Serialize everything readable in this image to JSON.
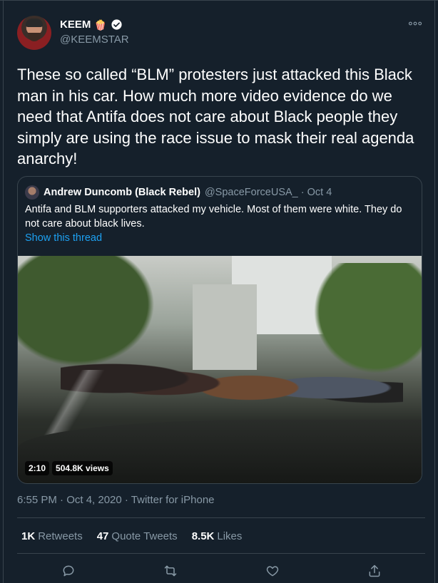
{
  "author": {
    "display_name": "KEEM",
    "handle": "@KEEMSTAR",
    "emoji": "🍿"
  },
  "tweet": {
    "text": "These so called “BLM” protesters just attacked this Black man in his car. How much more video evidence do we need that Antifa does not care about Black people they simply are using the race issue to mask their real agenda anarchy!"
  },
  "quoted": {
    "display_name": "Andrew Duncomb (Black Rebel)",
    "handle_date": "@SpaceForceUSA_ · Oct 4",
    "text": "Antifa and BLM supporters attacked my vehicle. Most of them were white. They do not care about black lives.",
    "show_thread": "Show this thread",
    "video": {
      "duration": "2:10",
      "views": "504.8K views"
    }
  },
  "meta": "6:55 PM · Oct 4, 2020 · Twitter for iPhone",
  "stats": {
    "retweets_num": "1K",
    "retweets_label": "Retweets",
    "quotes_num": "47",
    "quotes_label": "Quote Tweets",
    "likes_num": "8.5K",
    "likes_label": "Likes"
  },
  "icons": {
    "more": "more-icon",
    "verified": "verified-icon",
    "reply": "reply-icon",
    "retweet": "retweet-icon",
    "like": "like-icon",
    "share": "share-icon"
  },
  "colors": {
    "background": "#15202b",
    "border": "#38444d",
    "secondary_text": "#8899a6",
    "link": "#1da1f2"
  }
}
